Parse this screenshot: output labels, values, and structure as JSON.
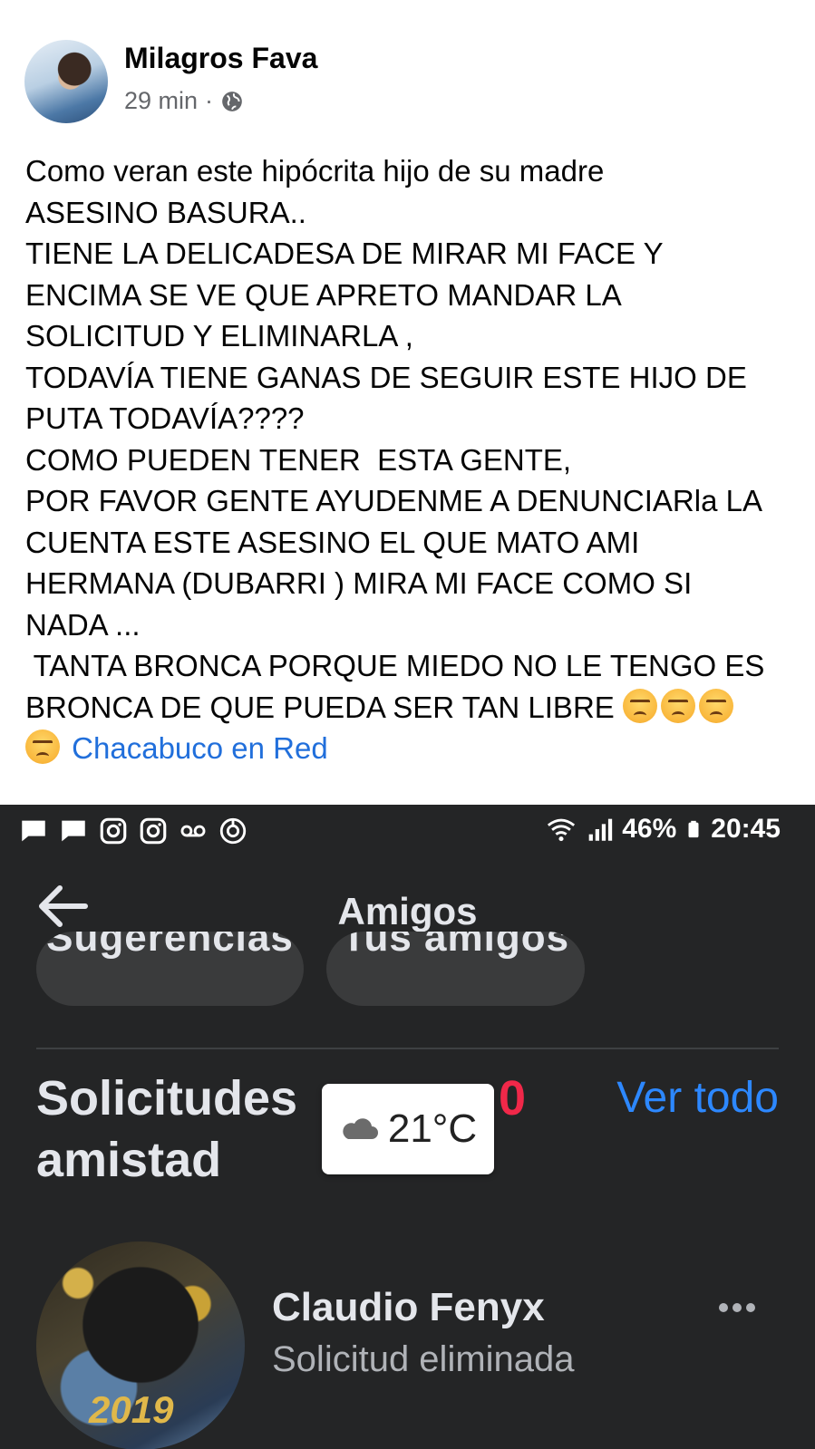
{
  "post": {
    "author": "Milagros Fava",
    "time": "29 min",
    "separator": "·",
    "audience_icon": "globe-icon",
    "lines": [
      "Como veran este hipócrita hijo de su madre",
      "ASESINO BASURA..",
      "TIENE LA DELICADESA DE MIRAR MI FACE Y",
      "ENCIMA SE VE QUE APRETO MANDAR LA",
      "SOLICITUD Y ELIMINARLA ,",
      "TODAVÍA TIENE GANAS DE SEGUIR ESTE HIJO DE",
      "PUTA TODAVÍA????",
      "COMO PUEDEN TENER  ESTA GENTE,",
      "POR FAVOR GENTE AYUDENME A DENUNCIARla LA",
      "CUENTA ESTE ASESINO EL QUE MATO AMI",
      "HERMANA (DUBARRI ) MIRA MI FACE COMO SI",
      "NADA ...",
      " TANTA BRONCA PORQUE MIEDO NO LE TENGO ES",
      "BRONCA DE QUE PUEDA SER TAN LIBRE"
    ],
    "group": "Chacabuco en Red",
    "emoji_icon": "angry-face-icon"
  },
  "screenshot": {
    "status_bar": {
      "battery": "46%",
      "time": "20:45"
    },
    "app_bar": {
      "title": "Amigos"
    },
    "chips": [
      "Sugerencias",
      "Tus amigos"
    ],
    "requests": {
      "title": "Solicitudes de amistad",
      "title_line1": "Solicitudes",
      "title_line2": "amistad",
      "count": "0",
      "see_all": "Ver todo"
    },
    "weather": {
      "temperature": "21°C",
      "icon": "cloud-icon"
    },
    "friend": {
      "name": "Claudio Fenyx",
      "status": "Solicitud eliminada",
      "avatar_text": "2019"
    }
  }
}
